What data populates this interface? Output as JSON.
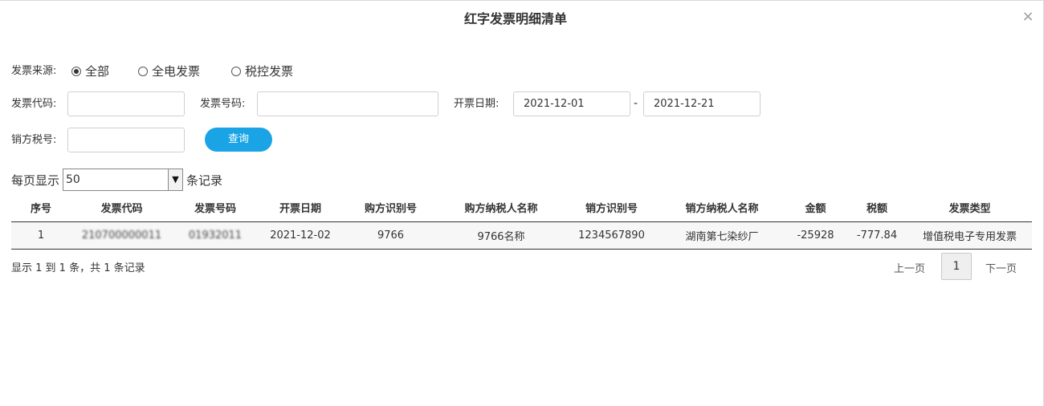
{
  "dialog": {
    "title": "红字发票明细清单",
    "close_symbol": "×"
  },
  "filters": {
    "source_label": "发票来源:",
    "source_options": [
      {
        "label": "全部",
        "checked": true
      },
      {
        "label": "全电发票",
        "checked": false
      },
      {
        "label": "税控发票",
        "checked": false
      }
    ],
    "code_label": "发票代码:",
    "code_value": "",
    "number_label": "发票号码:",
    "number_value": "",
    "date_label": "开票日期:",
    "date_from": "2021-12-01",
    "date_sep": "-",
    "date_to": "2021-12-21",
    "seller_tax_label": "销方税号:",
    "seller_tax_value": "",
    "query_label": "查询"
  },
  "page_size": {
    "prefix": "每页显示",
    "value": "50",
    "suffix": "条记录",
    "arrow": "▼"
  },
  "table": {
    "columns": [
      "序号",
      "发票代码",
      "发票号码",
      "开票日期",
      "购方识别号",
      "购方纳税人名称",
      "销方识别号",
      "销方纳税人名称",
      "金额",
      "税额",
      "发票类型"
    ],
    "rows": [
      {
        "index": "1",
        "invoice_code": "210700000011",
        "invoice_number": "01932011",
        "date": "2021-12-02",
        "buyer_id": "9766",
        "buyer_name": "9766名称",
        "seller_id": "1234567890",
        "seller_name": "湖南第七染纱厂",
        "amount": "-25928",
        "tax": "-777.84",
        "type": "增值税电子专用发票"
      }
    ]
  },
  "footer": {
    "summary": "显示 1 到 1 条，共 1 条记录",
    "prev": "上一页",
    "page": "1",
    "next": "下一页"
  }
}
